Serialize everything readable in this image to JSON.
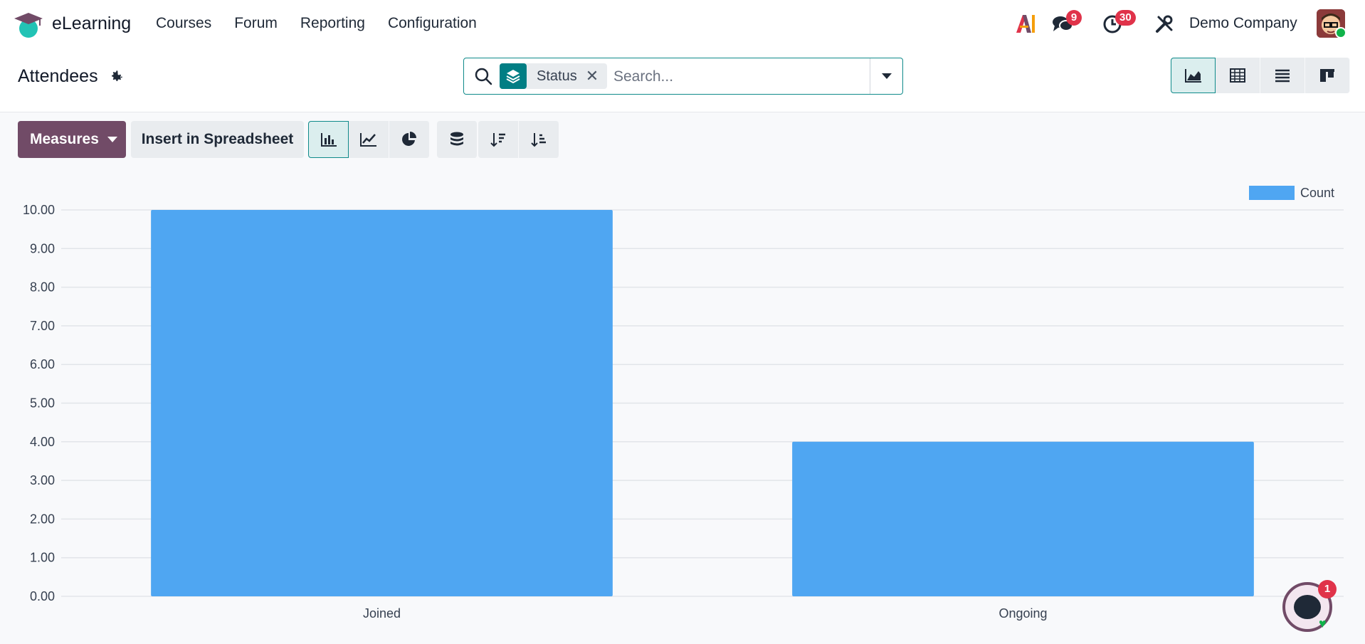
{
  "app": {
    "name": "eLearning"
  },
  "menu": [
    "Courses",
    "Forum",
    "Reporting",
    "Configuration"
  ],
  "header": {
    "chat_count": "9",
    "activity_count": "30",
    "company": "Demo Company"
  },
  "page": {
    "title": "Attendees"
  },
  "search": {
    "facet_label": "Status",
    "placeholder": "Search..."
  },
  "toolbar": {
    "measures_label": "Measures",
    "insert_label": "Insert in Spreadsheet"
  },
  "bot": {
    "badge": "1"
  },
  "colors": {
    "brand": "#714b67",
    "accent": "#017e84",
    "bar": "#4fa6f2",
    "badge": "#e0334a"
  },
  "icons": [
    "app-logo-icon",
    "ai-icon",
    "chat-icon",
    "clock-icon",
    "tools-icon",
    "gear-icon",
    "search-icon",
    "layers-icon",
    "close-icon",
    "area-chart-icon",
    "pivot-icon",
    "list-icon",
    "kanban-icon",
    "bar-chart-icon",
    "line-chart-icon",
    "pie-chart-icon",
    "stack-icon",
    "sort-desc-icon",
    "sort-asc-icon"
  ],
  "chart_data": {
    "type": "bar",
    "categories": [
      "Joined",
      "Ongoing"
    ],
    "series": [
      {
        "name": "Count",
        "values": [
          10,
          4
        ]
      }
    ],
    "ylim": [
      0,
      10
    ],
    "yticks": [
      "0.00",
      "1.00",
      "2.00",
      "3.00",
      "4.00",
      "5.00",
      "6.00",
      "7.00",
      "8.00",
      "9.00",
      "10.00"
    ],
    "grid": true,
    "legend_position": "top-right"
  }
}
